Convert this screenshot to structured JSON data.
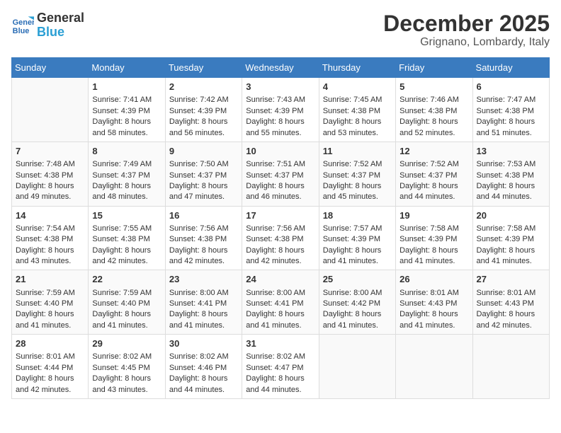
{
  "logo": {
    "line1": "General",
    "line2": "Blue"
  },
  "title": "December 2025",
  "location": "Grignano, Lombardy, Italy",
  "weekdays": [
    "Sunday",
    "Monday",
    "Tuesday",
    "Wednesday",
    "Thursday",
    "Friday",
    "Saturday"
  ],
  "weeks": [
    [
      {
        "day": "",
        "sunrise": "",
        "sunset": "",
        "daylight": ""
      },
      {
        "day": "1",
        "sunrise": "Sunrise: 7:41 AM",
        "sunset": "Sunset: 4:39 PM",
        "daylight": "Daylight: 8 hours and 58 minutes."
      },
      {
        "day": "2",
        "sunrise": "Sunrise: 7:42 AM",
        "sunset": "Sunset: 4:39 PM",
        "daylight": "Daylight: 8 hours and 56 minutes."
      },
      {
        "day": "3",
        "sunrise": "Sunrise: 7:43 AM",
        "sunset": "Sunset: 4:39 PM",
        "daylight": "Daylight: 8 hours and 55 minutes."
      },
      {
        "day": "4",
        "sunrise": "Sunrise: 7:45 AM",
        "sunset": "Sunset: 4:38 PM",
        "daylight": "Daylight: 8 hours and 53 minutes."
      },
      {
        "day": "5",
        "sunrise": "Sunrise: 7:46 AM",
        "sunset": "Sunset: 4:38 PM",
        "daylight": "Daylight: 8 hours and 52 minutes."
      },
      {
        "day": "6",
        "sunrise": "Sunrise: 7:47 AM",
        "sunset": "Sunset: 4:38 PM",
        "daylight": "Daylight: 8 hours and 51 minutes."
      }
    ],
    [
      {
        "day": "7",
        "sunrise": "Sunrise: 7:48 AM",
        "sunset": "Sunset: 4:38 PM",
        "daylight": "Daylight: 8 hours and 49 minutes."
      },
      {
        "day": "8",
        "sunrise": "Sunrise: 7:49 AM",
        "sunset": "Sunset: 4:37 PM",
        "daylight": "Daylight: 8 hours and 48 minutes."
      },
      {
        "day": "9",
        "sunrise": "Sunrise: 7:50 AM",
        "sunset": "Sunset: 4:37 PM",
        "daylight": "Daylight: 8 hours and 47 minutes."
      },
      {
        "day": "10",
        "sunrise": "Sunrise: 7:51 AM",
        "sunset": "Sunset: 4:37 PM",
        "daylight": "Daylight: 8 hours and 46 minutes."
      },
      {
        "day": "11",
        "sunrise": "Sunrise: 7:52 AM",
        "sunset": "Sunset: 4:37 PM",
        "daylight": "Daylight: 8 hours and 45 minutes."
      },
      {
        "day": "12",
        "sunrise": "Sunrise: 7:52 AM",
        "sunset": "Sunset: 4:37 PM",
        "daylight": "Daylight: 8 hours and 44 minutes."
      },
      {
        "day": "13",
        "sunrise": "Sunrise: 7:53 AM",
        "sunset": "Sunset: 4:38 PM",
        "daylight": "Daylight: 8 hours and 44 minutes."
      }
    ],
    [
      {
        "day": "14",
        "sunrise": "Sunrise: 7:54 AM",
        "sunset": "Sunset: 4:38 PM",
        "daylight": "Daylight: 8 hours and 43 minutes."
      },
      {
        "day": "15",
        "sunrise": "Sunrise: 7:55 AM",
        "sunset": "Sunset: 4:38 PM",
        "daylight": "Daylight: 8 hours and 42 minutes."
      },
      {
        "day": "16",
        "sunrise": "Sunrise: 7:56 AM",
        "sunset": "Sunset: 4:38 PM",
        "daylight": "Daylight: 8 hours and 42 minutes."
      },
      {
        "day": "17",
        "sunrise": "Sunrise: 7:56 AM",
        "sunset": "Sunset: 4:38 PM",
        "daylight": "Daylight: 8 hours and 42 minutes."
      },
      {
        "day": "18",
        "sunrise": "Sunrise: 7:57 AM",
        "sunset": "Sunset: 4:39 PM",
        "daylight": "Daylight: 8 hours and 41 minutes."
      },
      {
        "day": "19",
        "sunrise": "Sunrise: 7:58 AM",
        "sunset": "Sunset: 4:39 PM",
        "daylight": "Daylight: 8 hours and 41 minutes."
      },
      {
        "day": "20",
        "sunrise": "Sunrise: 7:58 AM",
        "sunset": "Sunset: 4:39 PM",
        "daylight": "Daylight: 8 hours and 41 minutes."
      }
    ],
    [
      {
        "day": "21",
        "sunrise": "Sunrise: 7:59 AM",
        "sunset": "Sunset: 4:40 PM",
        "daylight": "Daylight: 8 hours and 41 minutes."
      },
      {
        "day": "22",
        "sunrise": "Sunrise: 7:59 AM",
        "sunset": "Sunset: 4:40 PM",
        "daylight": "Daylight: 8 hours and 41 minutes."
      },
      {
        "day": "23",
        "sunrise": "Sunrise: 8:00 AM",
        "sunset": "Sunset: 4:41 PM",
        "daylight": "Daylight: 8 hours and 41 minutes."
      },
      {
        "day": "24",
        "sunrise": "Sunrise: 8:00 AM",
        "sunset": "Sunset: 4:41 PM",
        "daylight": "Daylight: 8 hours and 41 minutes."
      },
      {
        "day": "25",
        "sunrise": "Sunrise: 8:00 AM",
        "sunset": "Sunset: 4:42 PM",
        "daylight": "Daylight: 8 hours and 41 minutes."
      },
      {
        "day": "26",
        "sunrise": "Sunrise: 8:01 AM",
        "sunset": "Sunset: 4:43 PM",
        "daylight": "Daylight: 8 hours and 41 minutes."
      },
      {
        "day": "27",
        "sunrise": "Sunrise: 8:01 AM",
        "sunset": "Sunset: 4:43 PM",
        "daylight": "Daylight: 8 hours and 42 minutes."
      }
    ],
    [
      {
        "day": "28",
        "sunrise": "Sunrise: 8:01 AM",
        "sunset": "Sunset: 4:44 PM",
        "daylight": "Daylight: 8 hours and 42 minutes."
      },
      {
        "day": "29",
        "sunrise": "Sunrise: 8:02 AM",
        "sunset": "Sunset: 4:45 PM",
        "daylight": "Daylight: 8 hours and 43 minutes."
      },
      {
        "day": "30",
        "sunrise": "Sunrise: 8:02 AM",
        "sunset": "Sunset: 4:46 PM",
        "daylight": "Daylight: 8 hours and 44 minutes."
      },
      {
        "day": "31",
        "sunrise": "Sunrise: 8:02 AM",
        "sunset": "Sunset: 4:47 PM",
        "daylight": "Daylight: 8 hours and 44 minutes."
      },
      {
        "day": "",
        "sunrise": "",
        "sunset": "",
        "daylight": ""
      },
      {
        "day": "",
        "sunrise": "",
        "sunset": "",
        "daylight": ""
      },
      {
        "day": "",
        "sunrise": "",
        "sunset": "",
        "daylight": ""
      }
    ]
  ]
}
